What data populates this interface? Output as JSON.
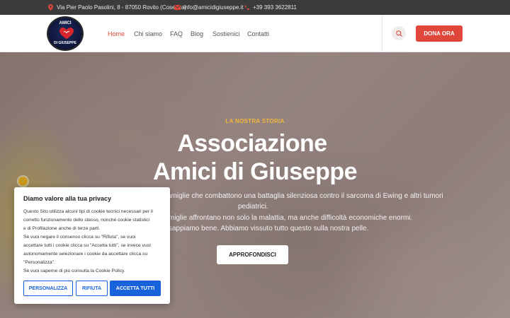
{
  "topbar": {
    "address": "Via Pier Paolo Pasolini, 8 - 87050 Rovito (Cosenza)",
    "email": "info@amicidigiuseppe.it",
    "phone": "+39 393 3622811"
  },
  "logo": {
    "line1": "AMICI",
    "line2": "DI GIUSEPPE"
  },
  "menu": [
    "Home",
    "Chi siamo",
    "FAQ",
    "Blog",
    "Sostienici",
    "Contatti"
  ],
  "header": {
    "cta": "DONA ORA"
  },
  "hero": {
    "eyebrow": "LA NOSTRA STORIA",
    "title_line1": "Associazione",
    "title_line2": "Amici di Giuseppe",
    "desc_line1": "amiglie che combattono una battaglia silenziosa contro il sarcoma di Ewing e altri tumori",
    "desc_line2": "pediatrici.",
    "desc_line3": "miglie affrontano non solo la malattia, ma anche difficoltà economiche enormi.",
    "desc_line4": "sappiamo bene. Abbiamo vissuto tutto questo sulla nostra pelle.",
    "button": "APPROFONDISCI"
  },
  "cookie": {
    "title": "Diamo valore alla tua privacy",
    "lines": [
      "Questo Sito utilizza alcuni tipi di cookie tecnici necessari per il",
      "corretto funzionamento dello stesso, nonché cookie statistici",
      "e di Profilazione anche di terze parti.",
      "Se vuoi negare il consenso clicca su \"Rifiuta\", se vuoi",
      "accettare tutti i cookie clicca su \"Accetta tutti\", se invece vuoi",
      "autonomamente selezionare i cookie da accettare clicca su",
      "\"Personalizza\".",
      "Se vuoi saperne di più consulta la Cookie Policy."
    ],
    "customize": "PERSONALIZZA",
    "reject": "RIFIUTA",
    "accept": "ACCETTA TUTTI"
  },
  "colors": {
    "accent": "#e0463a",
    "cookie_blue": "#1863dc",
    "eyebrow": "#f2b63b"
  }
}
